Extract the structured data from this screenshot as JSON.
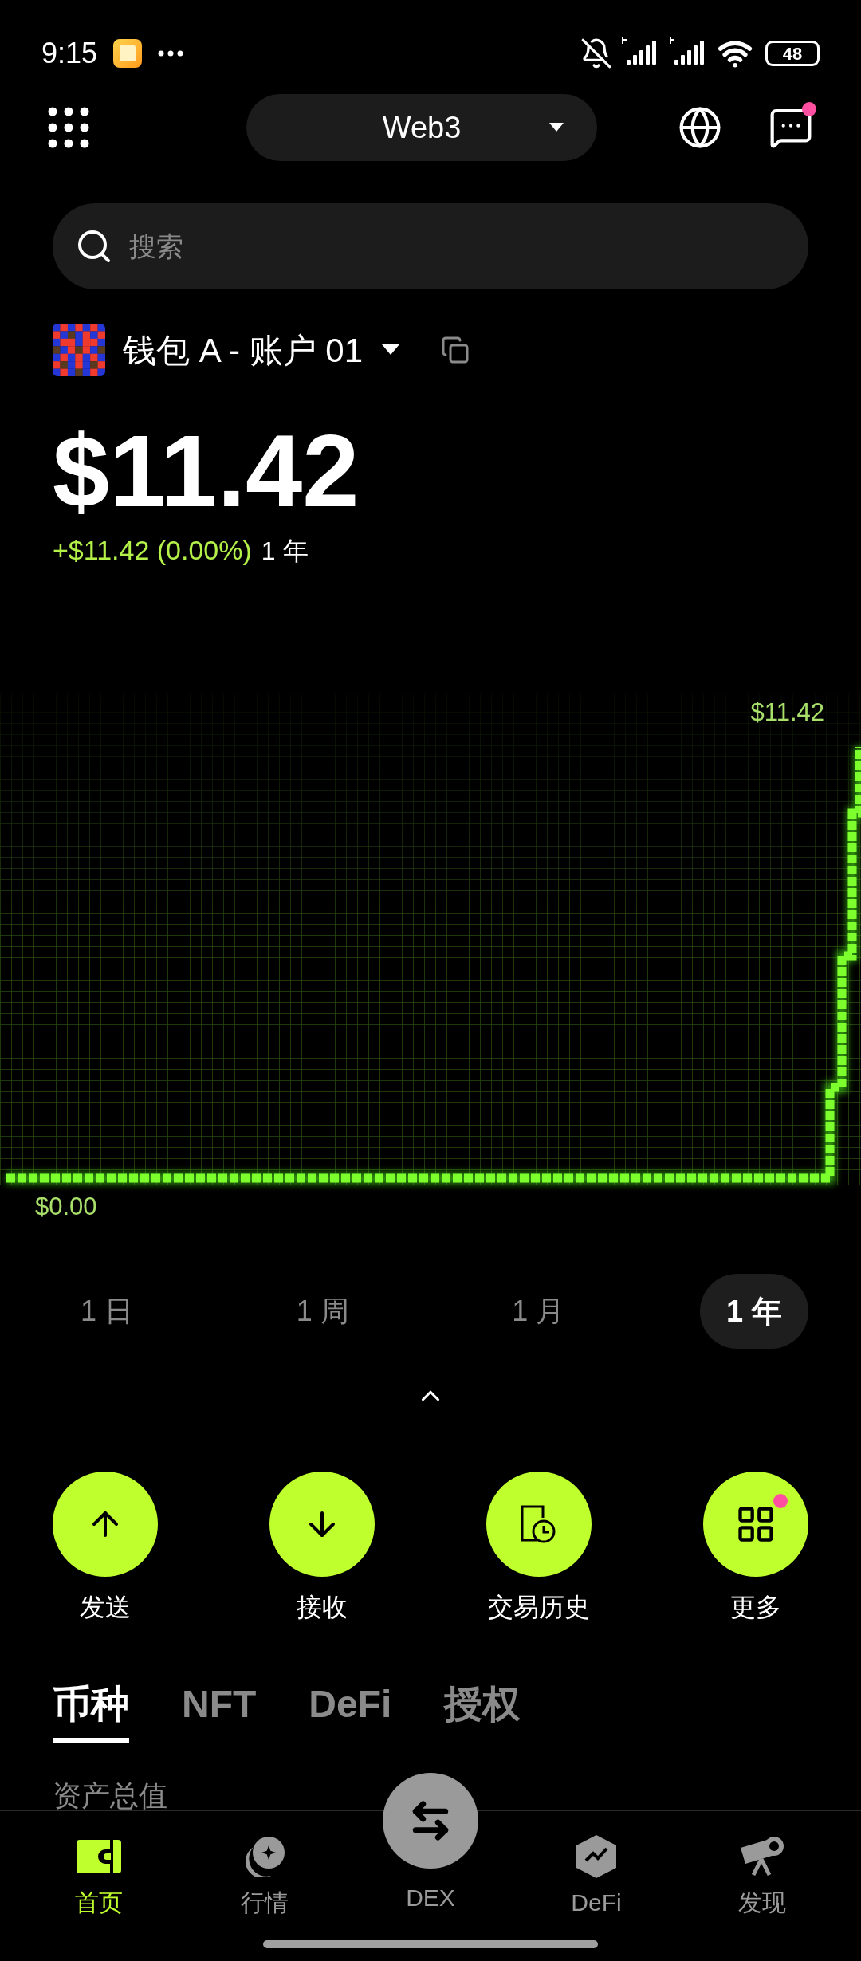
{
  "status_bar": {
    "time": "9:15",
    "battery": "48"
  },
  "header": {
    "network": "Web3",
    "has_notification": true
  },
  "search": {
    "placeholder": "搜索"
  },
  "account": {
    "name": "钱包 A - 账户 01"
  },
  "balance": {
    "amount": "$11.42",
    "change": "+$11.42 (0.00%)",
    "period": "1 年"
  },
  "chart": {
    "max_label": "$11.42",
    "min_label": "$0.00"
  },
  "ranges": [
    {
      "label": "1 日",
      "selected": false
    },
    {
      "label": "1 周",
      "selected": false
    },
    {
      "label": "1 月",
      "selected": false
    },
    {
      "label": "1 年",
      "selected": true
    }
  ],
  "actions": [
    {
      "label": "发送",
      "kind": "send",
      "badge": false
    },
    {
      "label": "接收",
      "kind": "receive",
      "badge": false
    },
    {
      "label": "交易历史",
      "kind": "history",
      "badge": false
    },
    {
      "label": "更多",
      "kind": "more",
      "badge": true
    }
  ],
  "asset_tabs": [
    {
      "label": "币种",
      "selected": true
    },
    {
      "label": "NFT",
      "selected": false
    },
    {
      "label": "DeFi",
      "selected": false
    },
    {
      "label": "授权",
      "selected": false
    }
  ],
  "section_heading": "资产总值",
  "nav": [
    {
      "label": "首页",
      "kind": "home",
      "selected": true
    },
    {
      "label": "行情",
      "kind": "market",
      "selected": false
    },
    {
      "label": "DEX",
      "kind": "dex",
      "selected": false
    },
    {
      "label": "DeFi",
      "kind": "defi",
      "selected": false
    },
    {
      "label": "发现",
      "kind": "discover",
      "selected": false
    }
  ]
}
